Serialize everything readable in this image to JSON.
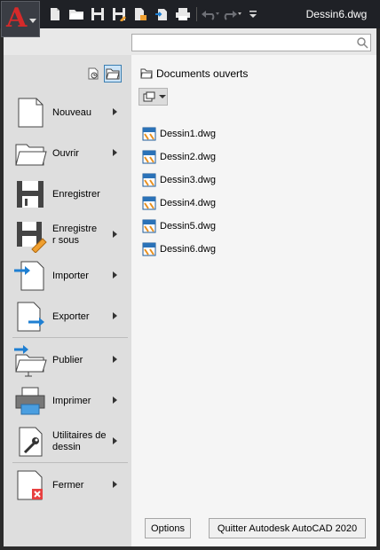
{
  "window": {
    "title": "Dessin6.dwg"
  },
  "search": {
    "value": "",
    "placeholder": ""
  },
  "menu": {
    "items": [
      {
        "label": "Nouveau",
        "has_submenu": true
      },
      {
        "label": "Ouvrir",
        "has_submenu": true
      },
      {
        "label": "Enregistrer",
        "has_submenu": false
      },
      {
        "label": "Enregistre\nr sous",
        "has_submenu": true
      },
      {
        "label": "Importer",
        "has_submenu": true
      },
      {
        "label": "Exporter",
        "has_submenu": true
      },
      {
        "label": "Publier",
        "has_submenu": true
      },
      {
        "label": "Imprimer",
        "has_submenu": true
      },
      {
        "label": "Utilitaires de dessin",
        "has_submenu": true
      },
      {
        "label": "Fermer",
        "has_submenu": true
      }
    ]
  },
  "documents": {
    "header": "Documents ouverts",
    "files": [
      "Dessin1.dwg",
      "Dessin2.dwg",
      "Dessin3.dwg",
      "Dessin4.dwg",
      "Dessin5.dwg",
      "Dessin6.dwg"
    ]
  },
  "buttons": {
    "options": "Options",
    "quit": "Quitter Autodesk AutoCAD 2020"
  },
  "colors": {
    "brand": "#d52a2a",
    "accent_blue": "#1e7fd2",
    "titlebar": "#1f2126"
  }
}
